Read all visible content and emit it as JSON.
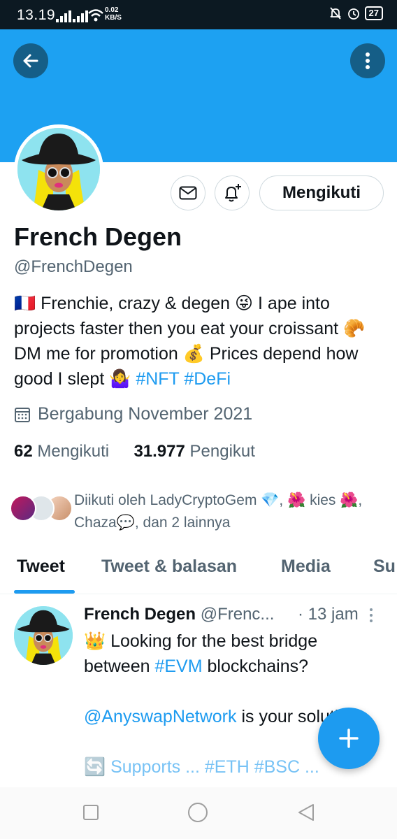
{
  "status_bar": {
    "time": "13.19",
    "net_speed_value": "0.02",
    "net_speed_unit": "KB/S",
    "battery": "27"
  },
  "banner": {
    "color": "#1da1f2",
    "back_icon": "arrow-left-icon",
    "more_icon": "more-vertical-icon"
  },
  "profile": {
    "display_name": "French Degen",
    "handle": "@FrenchDegen",
    "follow_button_label": "Mengikuti",
    "message_icon": "mail-icon",
    "notify_icon": "bell-plus-icon",
    "bio": {
      "flag": "🇫🇷",
      "part1": " Frenchie, crazy & degen ",
      "emoji_wink": "😜",
      "part2": " I ape into projects faster then you eat your croissant ",
      "emoji_croissant": "🥐",
      "part3": " DM me for promotion ",
      "emoji_money": "💰",
      "part4": " Prices depend how good I slept ",
      "emoji_shrug": "🤷‍♀️",
      "space": " ",
      "hashtag1": "#NFT",
      "hashtag2": "#DeFi"
    },
    "joined": "Bergabung November 2021",
    "following_count": "62",
    "following_label": "Mengikuti",
    "followers_count": "31.977",
    "followers_label": "Pengikut",
    "followed_by_text": "Diikuti oleh LadyCryptoGem 💎, 🌺 kies 🌺, Chaza💬, dan 2 lainnya"
  },
  "tabs": [
    {
      "label": "Tweet",
      "active": true
    },
    {
      "label": "Tweet & balasan",
      "active": false
    },
    {
      "label": "Media",
      "active": false
    },
    {
      "label": "Su",
      "active": false
    }
  ],
  "tweet": {
    "name": "French Degen",
    "handle": "@Frenc...",
    "time": "· 13 jam",
    "line1": "👑 Looking for the best bridge between ",
    "hashtag_evm": "#EVM",
    "line1_end": " blockchains?",
    "mention": "@AnyswapNetwork",
    "line2_end": " is your solution!",
    "line3_partial": "🔄 Supports  ...  #ETH  #BSC  ..."
  },
  "fab": {
    "icon": "plus-icon",
    "color": "#1d9bf0"
  },
  "nav": {
    "recents_icon": "square-icon",
    "home_icon": "circle-icon",
    "back_icon": "triangle-back-icon"
  }
}
